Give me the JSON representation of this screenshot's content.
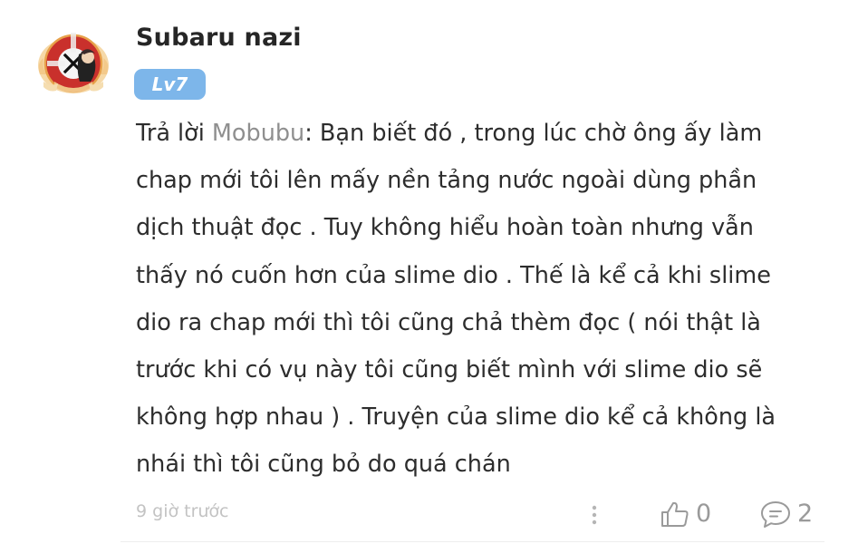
{
  "comment": {
    "author": "Subaru nazi",
    "level_badge": "Lv7",
    "reply_prefix": "Trả lời ",
    "reply_to": "Mobubu",
    "reply_sep": ":",
    "body_lines": [
      " Bạn biết đó , trong lúc chờ ông ấy làm",
      "chap mới tôi lên mấy nền tảng nước ngoài dùng phần",
      "dịch thuật đọc . Tuy không hiểu hoàn toàn nhưng vẫn",
      "thấy nó cuốn hơn của slime dio . Thế là kể cả khi slime",
      "dio ra chap mới thì tôi cũng chả thèm đọc ( nói thật là",
      "trước khi có vụ này tôi cũng biết mình với slime dio sẽ",
      "không hợp nhau ) . Truyện của slime dio kể cả không là",
      "nhái thì tôi cũng bỏ do quá chán"
    ],
    "timestamp": "9 giờ trước",
    "like_count": "0",
    "reply_count": "2"
  },
  "icons": {
    "avatar": "avatar-image",
    "more": "more-vertical-icon",
    "like": "thumbs-up-icon",
    "reply": "comment-bubble-icon"
  },
  "colors": {
    "badge": "#7db6ea",
    "mention": "#8f8f8f",
    "muted": "#c3c3c3",
    "counts": "#9a9a9a"
  }
}
